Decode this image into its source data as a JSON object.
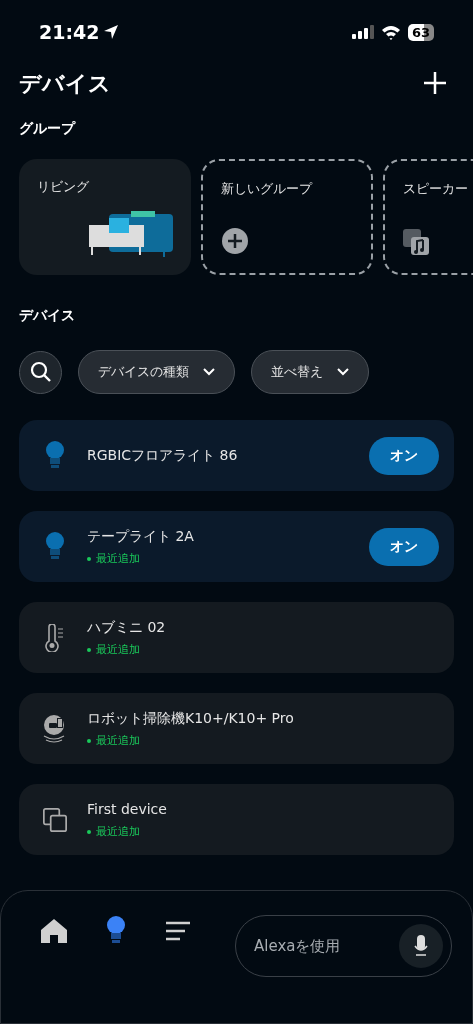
{
  "status_bar": {
    "time": "21:42",
    "battery": "63"
  },
  "header": {
    "title": "デバイス"
  },
  "groups": {
    "heading": "グループ",
    "items": [
      {
        "kind": "room",
        "label": "リビング"
      },
      {
        "kind": "new",
        "label": "新しいグループ"
      },
      {
        "kind": "speaker",
        "label": "スピーカー"
      }
    ]
  },
  "devices": {
    "heading": "デバイス",
    "filters": [
      {
        "label": "デバイスの種類"
      },
      {
        "label": "並べ替え"
      }
    ],
    "items": [
      {
        "kind": "light",
        "name": "RGBICフロアライト 86",
        "on": true,
        "power_label": "オン"
      },
      {
        "kind": "light",
        "name": "テープライト 2A",
        "on": true,
        "power_label": "オン",
        "badge": "最近追加"
      },
      {
        "kind": "thermometer",
        "name": "ハブミニ 02",
        "badge": "最近追加"
      },
      {
        "kind": "vacuum",
        "name": "ロボット掃除機K10+/K10+ Pro",
        "badge": "最近追加"
      },
      {
        "kind": "generic",
        "name": "First device",
        "badge": "最近追加"
      }
    ]
  },
  "bottom_nav": {
    "tabs": [
      {
        "kind": "home",
        "selected": false
      },
      {
        "kind": "devices",
        "selected": true
      },
      {
        "kind": "more",
        "selected": false
      }
    ],
    "alexa": {
      "placeholder": "Alexaを使用"
    }
  }
}
